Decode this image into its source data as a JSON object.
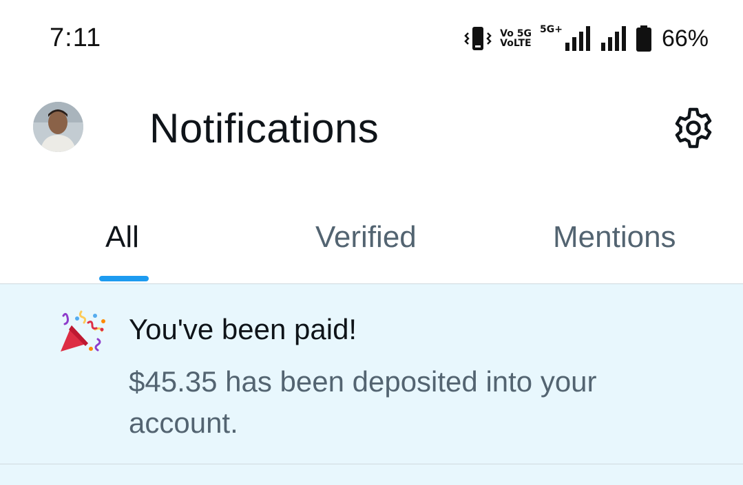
{
  "status_bar": {
    "time": "7:11",
    "network_top": "Vo 5G",
    "network_bottom": "VoLTE",
    "network_type": "5G+",
    "battery": "66%"
  },
  "header": {
    "title": "Notifications",
    "avatar_icon": "profile-avatar",
    "settings_icon": "gear-icon"
  },
  "tabs": [
    {
      "label": "All",
      "active": true
    },
    {
      "label": "Verified",
      "active": false
    },
    {
      "label": "Mentions",
      "active": false
    }
  ],
  "notification": {
    "icon": "party-popper-icon",
    "title": "You've been paid!",
    "body": "$45.35 has been deposited into your account."
  },
  "colors": {
    "accent": "#1d9bf0",
    "notification_bg": "#e8f7fd",
    "secondary_text": "#536471",
    "primary_text": "#0f1419"
  }
}
